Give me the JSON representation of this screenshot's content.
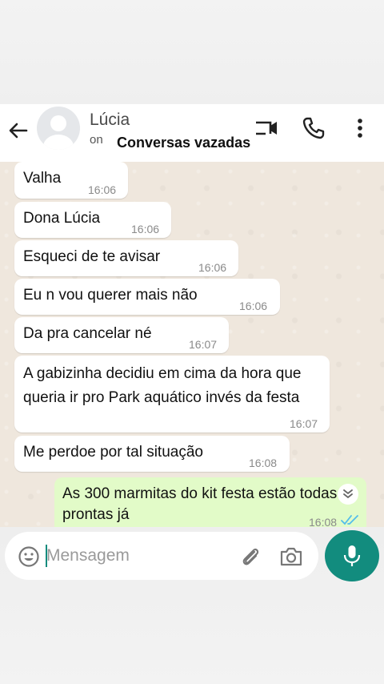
{
  "header": {
    "contact_name": "Lúcia",
    "status_prefix": "on",
    "overlay_caption": "Conversas vazadas"
  },
  "messages": [
    {
      "text": "Valha",
      "time": "16:06"
    },
    {
      "text": "Dona Lúcia",
      "time": "16:06"
    },
    {
      "text": "Esqueci de te avisar",
      "time": "16:06"
    },
    {
      "text": "Eu n vou querer mais não",
      "time": "16:06"
    },
    {
      "text": "Da pra cancelar né",
      "time": "16:07"
    },
    {
      "text": "A gabizinha decidiu em cima da hora que queria ir pro Park aquático invés da festa",
      "time": "16:07"
    },
    {
      "text": "Me perdoe por tal situação",
      "time": "16:08"
    }
  ],
  "outgoing": {
    "text": "As 300 marmitas do kit festa estão todas prontas já",
    "time": "16:08"
  },
  "composer": {
    "placeholder": "Mensagem"
  },
  "colors": {
    "accent": "#128c7e",
    "outgoing_bubble": "#e2fbc8",
    "chat_background": "#efe7dd",
    "read_ticks": "#53bdeb"
  },
  "icons": [
    "back-arrow-icon",
    "avatar-placeholder-icon",
    "video-call-icon",
    "phone-icon",
    "more-options-icon",
    "scroll-down-chevron-icon",
    "double-check-icon",
    "emoji-icon",
    "attach-icon",
    "camera-icon",
    "mic-icon"
  ]
}
